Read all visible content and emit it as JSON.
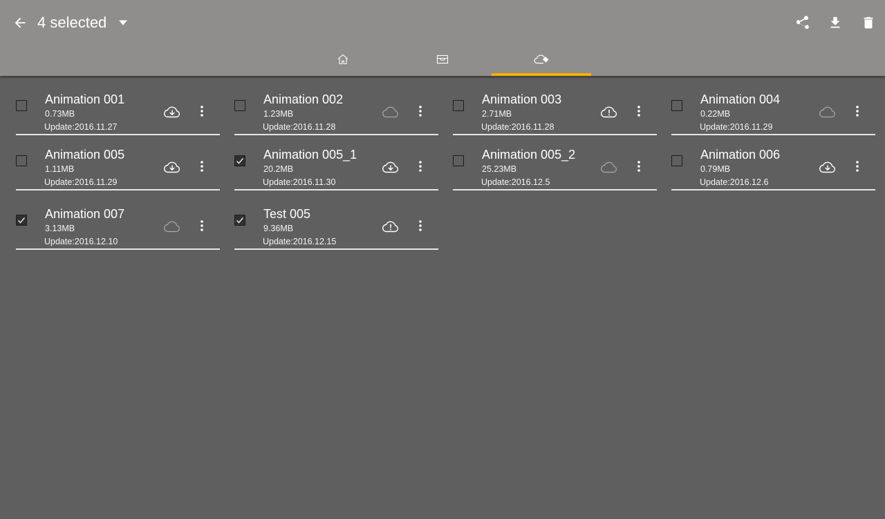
{
  "colors": {
    "accent": "#f3b200",
    "appbar": "#8f8e8c",
    "background": "#5f5f5f"
  },
  "header": {
    "back_icon": "arrow-left-icon",
    "title": "4 selected",
    "dropdown_icon": "caret-down-icon",
    "actions": [
      {
        "name": "share",
        "icon": "share-icon"
      },
      {
        "name": "download",
        "icon": "download-icon"
      },
      {
        "name": "delete",
        "icon": "trash-icon"
      }
    ]
  },
  "tabs": [
    {
      "name": "home",
      "icon": "home-icon",
      "active": false
    },
    {
      "name": "storage",
      "icon": "archive-box-icon",
      "active": false
    },
    {
      "name": "cloud",
      "icon": "cloud-icon",
      "active": true
    }
  ],
  "files": [
    {
      "name": "Animation 001",
      "size": "0.73MB",
      "updated": "Update:2016.11.27",
      "checked": false,
      "cloud_status": "cloud-download-icon"
    },
    {
      "name": "Animation 002",
      "size": "1.23MB",
      "updated": "Update:2016.11.28",
      "checked": false,
      "cloud_status": "cloud-icon"
    },
    {
      "name": "Animation 003",
      "size": "2.71MB",
      "updated": "Update:2016.11.28",
      "checked": false,
      "cloud_status": "cloud-alert-icon"
    },
    {
      "name": "Animation 004",
      "size": "0.22MB",
      "updated": "Update:2016.11.29",
      "checked": false,
      "cloud_status": "cloud-icon"
    },
    {
      "name": "Animation 005",
      "size": "1.11MB",
      "updated": "Update:2016.11.29",
      "checked": false,
      "cloud_status": "cloud-download-icon"
    },
    {
      "name": "Animation 005_1",
      "size": "20.2MB",
      "updated": "Update:2016.11.30",
      "checked": true,
      "cloud_status": "cloud-download-icon"
    },
    {
      "name": "Animation 005_2",
      "size": "25.23MB",
      "updated": "Update:2016.12.5",
      "checked": false,
      "cloud_status": "cloud-icon"
    },
    {
      "name": "Animation 006",
      "size": "0.79MB",
      "updated": "Update:2016.12.6",
      "checked": false,
      "cloud_status": "cloud-download-icon"
    },
    {
      "name": "Animation 007",
      "size": "3.13MB",
      "updated": "Update:2016.12.10",
      "checked": true,
      "cloud_status": "cloud-icon"
    },
    {
      "name": "Test 005",
      "size": "9.36MB",
      "updated": "Update:2016.12.15",
      "checked": true,
      "cloud_status": "cloud-alert-icon"
    }
  ]
}
